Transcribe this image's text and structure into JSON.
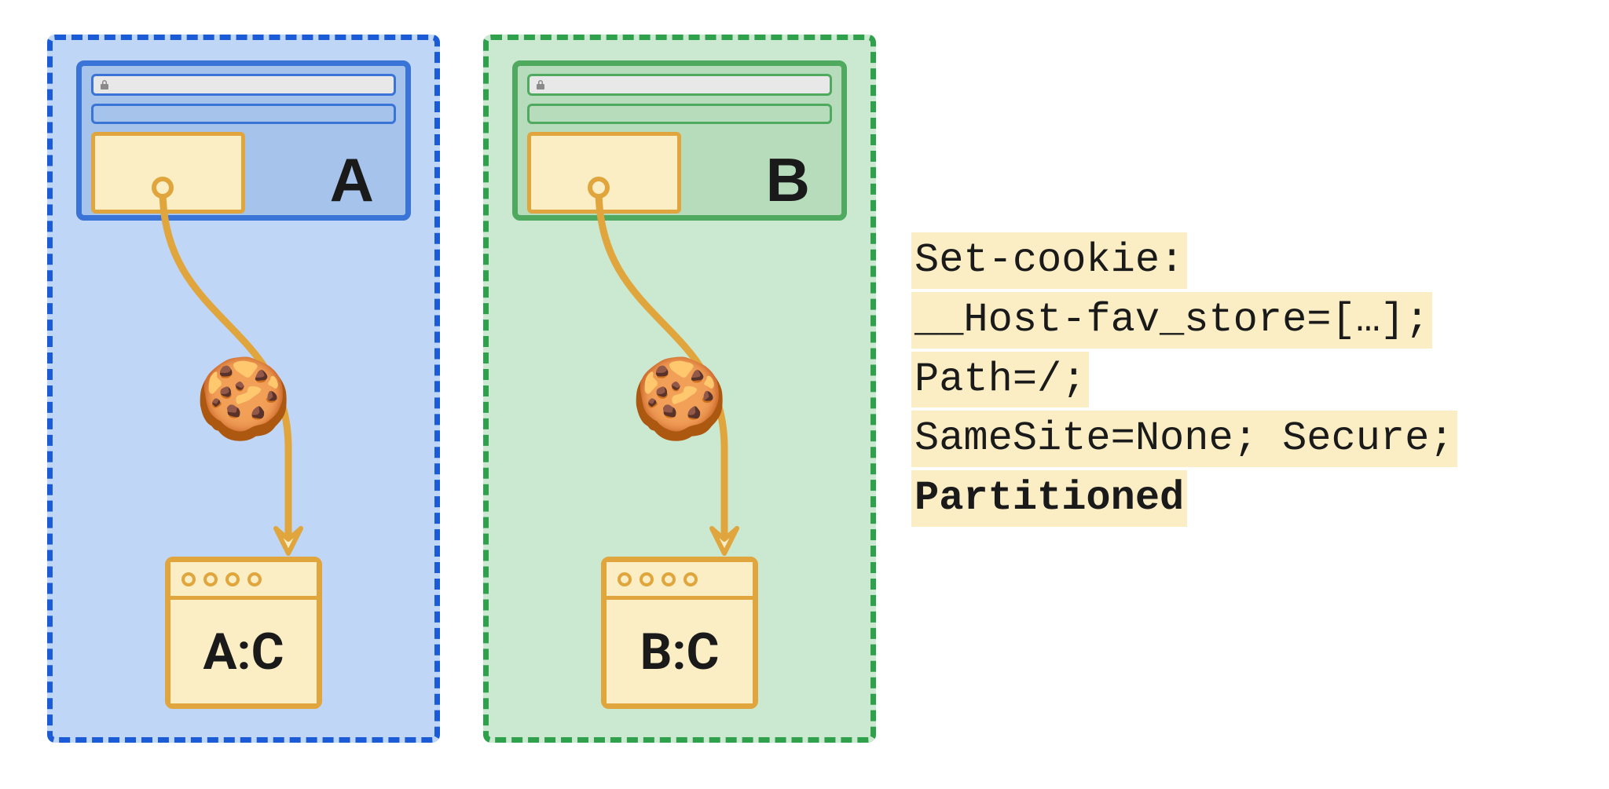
{
  "partitions": [
    {
      "site_label": "A",
      "jar_label": "A:C"
    },
    {
      "site_label": "B",
      "jar_label": "B:C"
    }
  ],
  "code": {
    "line1": "Set-cookie:",
    "line2": "__Host-fav_store=[…];",
    "line3": "Path=/;",
    "line4": "SameSite=None; Secure;",
    "line5": "Partitioned"
  },
  "colors": {
    "blue_border": "#1b5bd6",
    "blue_fill": "#c0d6f7",
    "green_border": "#2fa04b",
    "green_fill": "#cbe8d0",
    "orange_border": "#e0a63d",
    "orange_fill": "#fbeec4"
  }
}
